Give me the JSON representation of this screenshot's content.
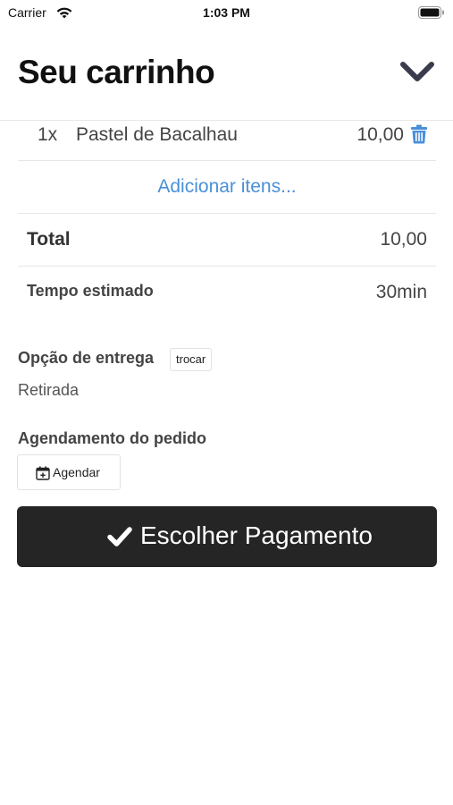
{
  "status_bar": {
    "carrier": "Carrier",
    "time": "1:03 PM"
  },
  "header": {
    "title": "Seu carrinho",
    "collapse_icon": "chevron-down-icon"
  },
  "cart": {
    "items": [
      {
        "qty": "1x",
        "name": "Pastel de Bacalhau",
        "price": "10,00",
        "remove_icon": "trash-icon"
      }
    ],
    "add_items_label": "Adicionar itens..."
  },
  "summary": {
    "total_label": "Total",
    "total_value": "10,00",
    "time_label": "Tempo estimado",
    "time_value": "30min"
  },
  "delivery": {
    "label": "Opção de entrega",
    "change_label": "trocar",
    "value": "Retirada"
  },
  "schedule": {
    "label": "Agendamento do pedido",
    "button_label": "Agendar",
    "button_icon": "calendar-plus-icon"
  },
  "payment": {
    "button_label": "Escolher Pagamento",
    "button_icon": "check-icon"
  },
  "colors": {
    "link": "#4a90d9",
    "primary_button": "#252525",
    "chevron": "#3a3b4d"
  }
}
